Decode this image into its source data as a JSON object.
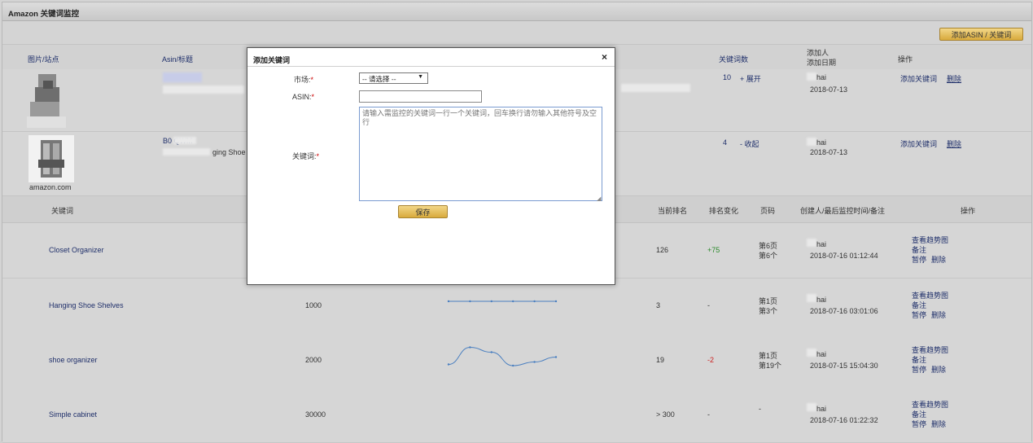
{
  "app": {
    "title": "Amazon 关键词监控",
    "add_button": "添加ASIN / 关键词"
  },
  "asin_table": {
    "headers": {
      "image_site": "图片/站点",
      "asin_title": "Asin/标题",
      "keyword_count": "关键词数",
      "adder": "添加人",
      "added_date": "添加日期",
      "actions": "操作"
    },
    "rows": [
      {
        "asin": "",
        "title_fragment": "",
        "keyword_count": "10",
        "toggle": "+ 展开",
        "adder": "hai",
        "date": "2018-07-13",
        "add_keyword": "添加关键词",
        "delete": "删除",
        "site": ""
      },
      {
        "asin": "B0      QWM",
        "title_fragment": "ging Shoe Sh",
        "keyword_count": "4",
        "toggle": "- 收起",
        "adder": "hai",
        "date": "2018-07-13",
        "add_keyword": "添加关键词",
        "delete": "删除",
        "site": "amazon.com"
      }
    ]
  },
  "keyword_table": {
    "headers": {
      "keyword": "关键词",
      "current_rank": "当前排名",
      "rank_change": "排名变化",
      "page": "页码",
      "creator": "创建人/最后监控时间/备注",
      "actions": "操作"
    },
    "rows": [
      {
        "keyword": "Closet Organizer",
        "volume": "",
        "rank": "126",
        "change": "+75",
        "change_color": "#2c8a2c",
        "page_line1": "第6页",
        "page_line2": "第6个",
        "creator": "hai",
        "time": "2018-07-16 01:12:44",
        "trend": [
          0.5,
          0.5,
          0.5,
          0.5,
          0.5,
          0.5
        ]
      },
      {
        "keyword": "Hanging Shoe Shelves",
        "volume": "1000",
        "rank": "3",
        "change": "-",
        "change_color": "#333333",
        "page_line1": "第1页",
        "page_line2": "第3个",
        "creator": "hai",
        "time": "2018-07-16 03:01:06",
        "trend": [
          0.5,
          0.5,
          0.5,
          0.5,
          0.5,
          0.5
        ]
      },
      {
        "keyword": "shoe organizer",
        "volume": "2000",
        "rank": "19",
        "change": "-2",
        "change_color": "#cc2222",
        "page_line1": "第1页",
        "page_line2": "第19个",
        "creator": "hai",
        "time": "2018-07-15 15:04:30",
        "trend": [
          0.85,
          0.15,
          0.35,
          0.9,
          0.75,
          0.55
        ]
      },
      {
        "keyword": "Simple cabinet",
        "volume": "30000",
        "rank": "> 300",
        "change": "-",
        "change_color": "#333333",
        "page_line1": "-",
        "page_line2": "",
        "creator": "hai",
        "time": "2018-07-16 01:22:32",
        "trend": []
      }
    ],
    "action_labels": {
      "trend": "查看趋势图",
      "note": "备注",
      "pause": "暂停",
      "delete": "删除"
    }
  },
  "dialog": {
    "title": "添加关键词",
    "close": "×",
    "market_label": "市场:",
    "market_value": "-- 请选择 --",
    "asin_label": "ASIN:",
    "asin_value": "",
    "keyword_label": "关键词:",
    "required_mark": "*",
    "keyword_placeholder": "请输入需监控的关键词一行一个关键词，回车换行请勿输入其他符号及空行",
    "save": "保存"
  }
}
